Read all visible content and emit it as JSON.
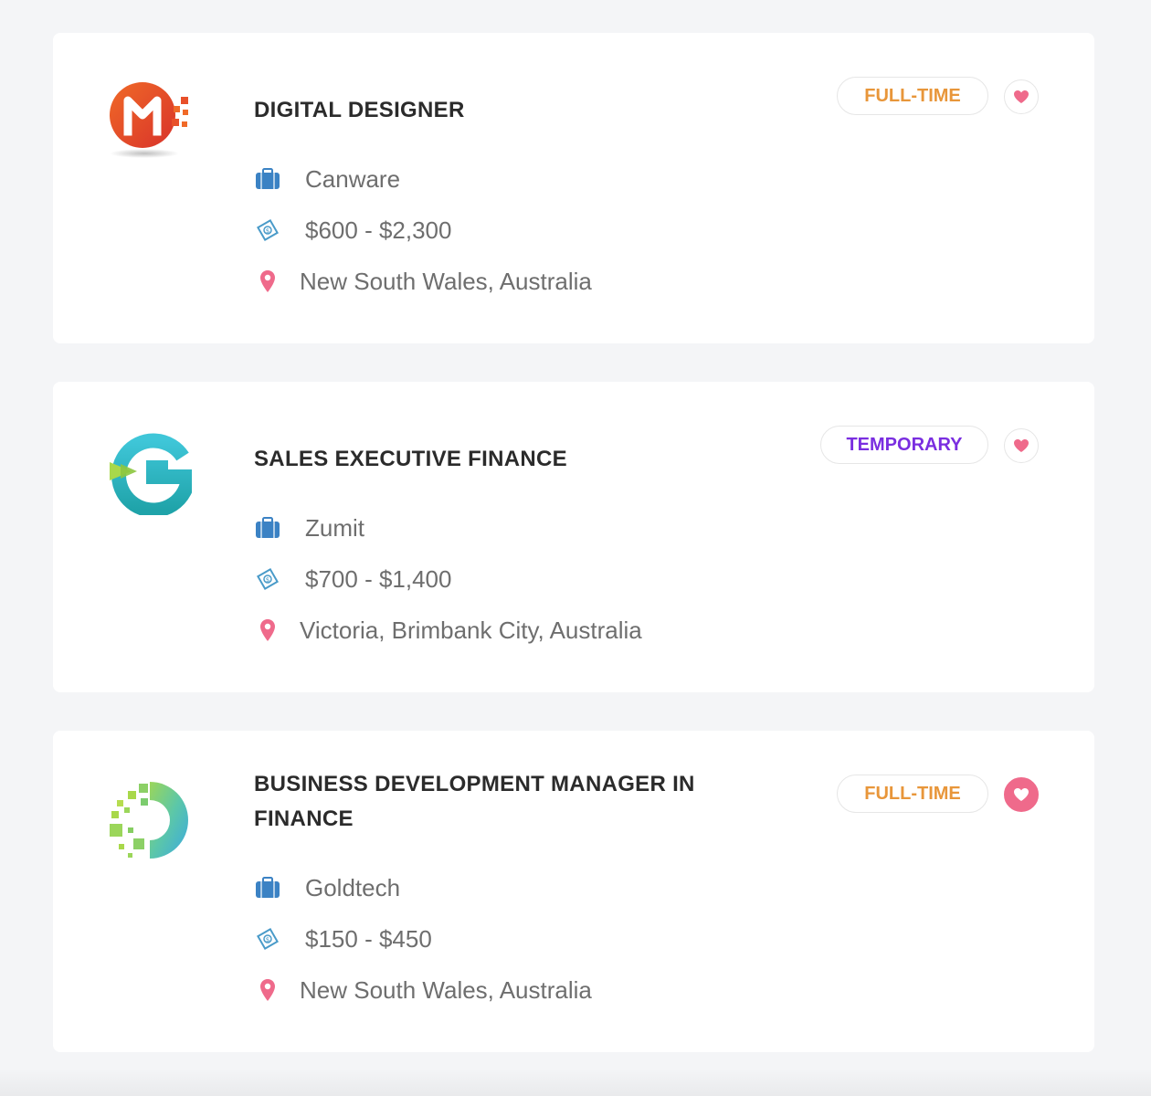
{
  "colors": {
    "fulltime": "#e8963a",
    "temporary": "#7a2ee0",
    "briefcase": "#3b82c4",
    "salary": "#4a9bc9",
    "pin": "#ef6a8b",
    "heart": "#ef6a8b"
  },
  "jobs": [
    {
      "title": "DIGITAL DESIGNER",
      "company": "Canware",
      "salary": "$600 - $2,300",
      "location": "New South Wales, Australia",
      "type": "FULL-TIME",
      "favorited": false,
      "logo_icon": "m-logo-icon"
    },
    {
      "title": "SALES EXECUTIVE FINANCE",
      "company": "Zumit",
      "salary": "$700 - $1,400",
      "location": "Victoria, Brimbank City, Australia",
      "type": "TEMPORARY",
      "favorited": false,
      "logo_icon": "g-logo-icon"
    },
    {
      "title": "BUSINESS DEVELOPMENT MANAGER IN FINANCE",
      "company": "Goldtech",
      "salary": "$150 - $450",
      "location": "New South Wales, Australia",
      "type": "FULL-TIME",
      "favorited": true,
      "logo_icon": "pixel-logo-icon"
    }
  ]
}
